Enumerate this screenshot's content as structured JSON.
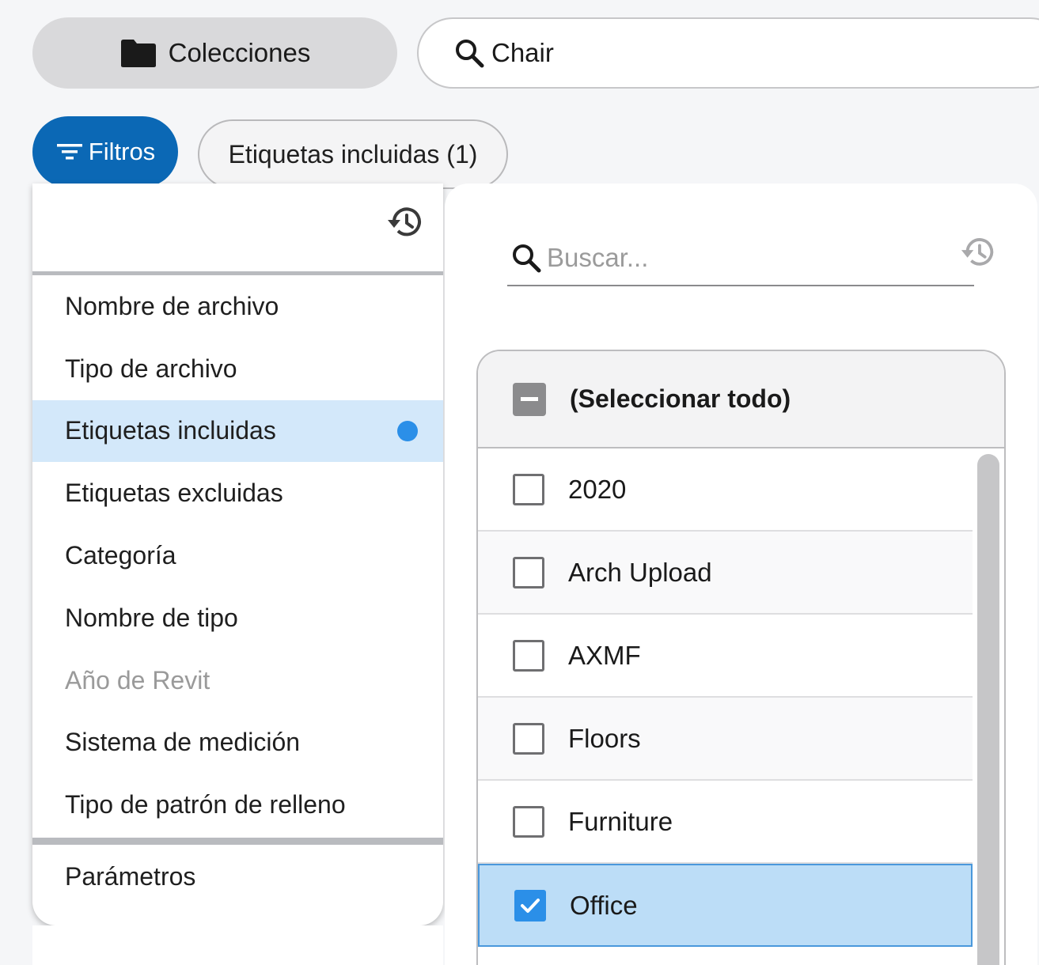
{
  "header": {
    "collections_label": "Colecciones",
    "search_value": "Chair"
  },
  "filter_bar": {
    "filters_label": "Filtros",
    "active_chip": "Etiquetas incluidas (1)"
  },
  "left_menu": {
    "items": [
      {
        "label": "Nombre de archivo",
        "state": "normal"
      },
      {
        "label": "Tipo de archivo",
        "state": "normal"
      },
      {
        "label": "Etiquetas incluidas",
        "state": "active"
      },
      {
        "label": "Etiquetas excluidas",
        "state": "normal"
      },
      {
        "label": "Categoría",
        "state": "normal"
      },
      {
        "label": "Nombre de tipo",
        "state": "normal"
      },
      {
        "label": "Año de Revit",
        "state": "disabled"
      },
      {
        "label": "Sistema de medición",
        "state": "normal"
      },
      {
        "label": "Tipo de patrón de relleno",
        "state": "normal"
      }
    ],
    "params_label": "Parámetros"
  },
  "right_panel": {
    "search_placeholder": "Buscar...",
    "select_all_label": "(Seleccionar todo)",
    "options": [
      {
        "label": "2020",
        "checked": false
      },
      {
        "label": "Arch Upload",
        "checked": false
      },
      {
        "label": "AXMF",
        "checked": false
      },
      {
        "label": "Floors",
        "checked": false
      },
      {
        "label": "Furniture",
        "checked": false
      },
      {
        "label": "Office",
        "checked": true
      }
    ]
  },
  "colors": {
    "primary": "#0b68b5",
    "accent": "#2b8fe8",
    "active_bg": "#d3e8fa",
    "selected_row_bg": "#bcddf7"
  }
}
